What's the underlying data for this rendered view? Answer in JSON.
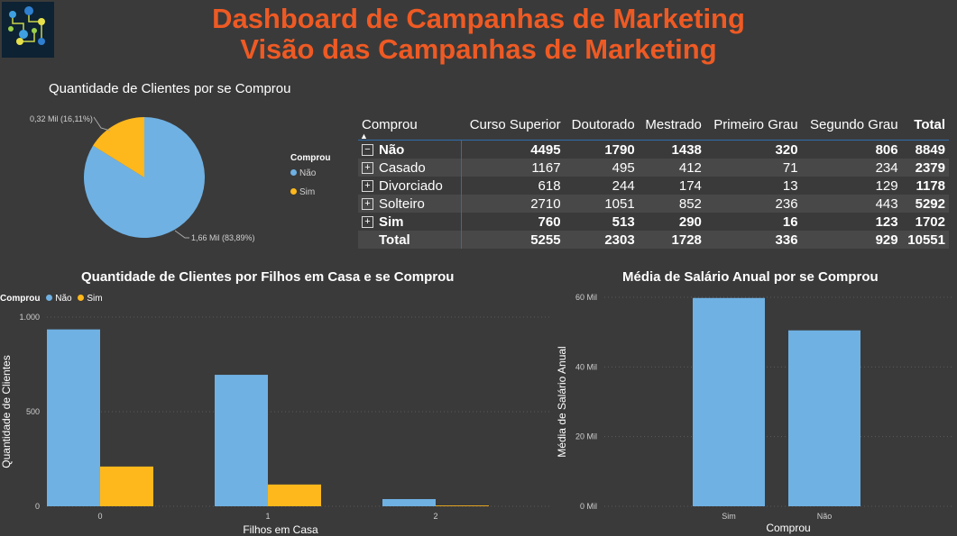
{
  "header": {
    "title_line1": "Dashboard de Campanhas de Marketing",
    "title_line2": "Visão das Campanhas de Marketing",
    "logo_icon": "network-nodes-icon"
  },
  "pie": {
    "title": "Quantidade de Clientes por se Comprou",
    "legend_title": "Comprou",
    "legend_items": [
      {
        "label": "Não",
        "color": "#6fb1e3"
      },
      {
        "label": "Sim",
        "color": "#ffb81c"
      }
    ],
    "label_sim": "0,32 Mil (16,11%)",
    "label_nao": "1,66 Mil (83,89%)"
  },
  "matrix": {
    "columns": [
      "Comprou",
      "Curso Superior",
      "Doutorado",
      "Mestrado",
      "Primeiro Grau",
      "Segundo Grau",
      "Total"
    ],
    "rows": [
      {
        "label": "Não",
        "level": 0,
        "expander": "−",
        "values": [
          "4495",
          "1790",
          "1438",
          "320",
          "806",
          "8849"
        ]
      },
      {
        "label": "Casado",
        "level": 1,
        "expander": "+",
        "values": [
          "1167",
          "495",
          "412",
          "71",
          "234",
          "2379"
        ]
      },
      {
        "label": "Divorciado",
        "level": 1,
        "expander": "+",
        "values": [
          "618",
          "244",
          "174",
          "13",
          "129",
          "1178"
        ]
      },
      {
        "label": "Solteiro",
        "level": 1,
        "expander": "+",
        "values": [
          "2710",
          "1051",
          "852",
          "236",
          "443",
          "5292"
        ]
      },
      {
        "label": "Sim",
        "level": 0,
        "expander": "+",
        "values": [
          "760",
          "513",
          "290",
          "16",
          "123",
          "1702"
        ]
      },
      {
        "label": "Total",
        "level": 0,
        "expander": "",
        "values": [
          "5255",
          "2303",
          "1728",
          "336",
          "929",
          "10551"
        ]
      }
    ]
  },
  "chart_data": [
    {
      "type": "pie",
      "title": "Quantidade de Clientes por se Comprou",
      "legend_title": "Comprou",
      "categories": [
        "Não",
        "Sim"
      ],
      "values": [
        1660,
        320
      ],
      "percentages": [
        83.89,
        16.11
      ],
      "colors": [
        "#6fb1e3",
        "#ffb81c"
      ]
    },
    {
      "type": "bar",
      "title": "Quantidade de Clientes por Filhos em Casa e se Comprou",
      "legend_title": "Comprou",
      "categories": [
        "0",
        "1",
        "2"
      ],
      "series": [
        {
          "name": "Não",
          "color": "#6fb1e3",
          "values": [
            935,
            695,
            38
          ]
        },
        {
          "name": "Sim",
          "color": "#ffb81c",
          "values": [
            210,
            115,
            4
          ]
        }
      ],
      "xlabel": "Filhos em Casa",
      "ylabel": "Quantidade de Clientes",
      "ylim": [
        0,
        1000
      ],
      "yticks": [
        "0",
        "500",
        "1.000"
      ],
      "grid": true
    },
    {
      "type": "bar",
      "title": "Média de Salário Anual por se Comprou",
      "categories": [
        "Sim",
        "Não"
      ],
      "values": [
        59800,
        50500
      ],
      "colors": [
        "#6fb1e3",
        "#6fb1e3"
      ],
      "xlabel": "Comprou",
      "ylabel": "Média de Salário Anual",
      "ylim": [
        0,
        60000
      ],
      "yticks": [
        "0 Mil",
        "20 Mil",
        "40 Mil",
        "60 Mil"
      ],
      "grid": true
    }
  ]
}
